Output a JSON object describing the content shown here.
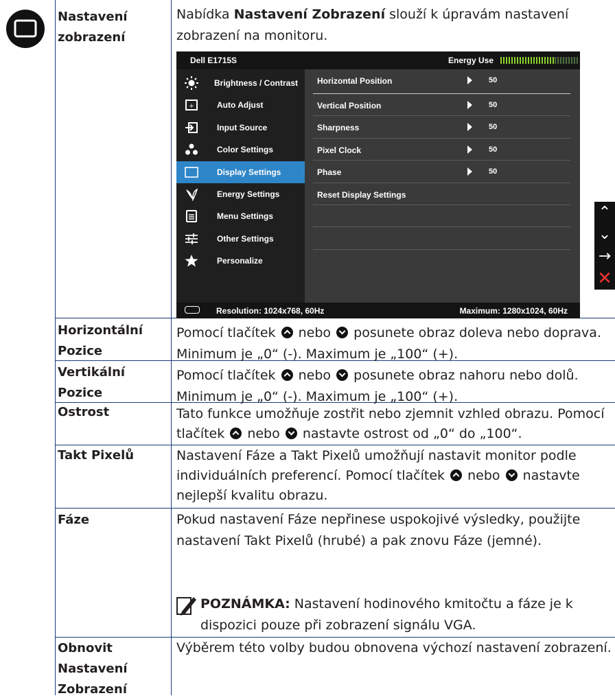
{
  "icon_names": {
    "section": "monitor-circle-icon",
    "note": "pencil-note-icon"
  },
  "colors": {
    "table_border": "#1a3a7a",
    "osd_selected": "#2e86c8",
    "energy_bar": "#8ed12a",
    "exit_key": "#e33333"
  },
  "rows": [
    {
      "label": "Nastavení\nzobrazení",
      "intro_pre": "Nabídka ",
      "intro_bold": "Nastavení Zobrazení",
      "intro_post": " slouží k úpravám nastavení zobrazení na monitoru."
    },
    {
      "label": "Horizontální\nPozice",
      "pre": "Pomocí tlačítek ",
      "mid": " nebo ",
      "post": " posunete obraz doleva nebo doprava. Minimum je „0“ (-). Maximum je „100“ (+)."
    },
    {
      "label": "Vertikální\nPozice",
      "pre": "Pomocí tlačítek ",
      "mid": " nebo ",
      "post": " posunete obraz nahoru nebo dolů. Minimum je „0“ (-). Maximum je „100“ (+)."
    },
    {
      "label": "Ostrost",
      "line1": "Tato funkce umožňuje zostřit nebo zjemnit vzhled obrazu.",
      "pre": "Pomocí tlačítek ",
      "mid": " nebo ",
      "post": " nastavte ostrost od „0“ do „100“."
    },
    {
      "label": "Takt Pixelů",
      "pre": "Nastavení Fáze a Takt Pixelů umožňují nastavit monitor podle individuálních preferencí. Pomocí tlačítek ",
      "mid": " nebo ",
      "post": " nastavte nejlepší kvalitu obrazu."
    },
    {
      "label": "Fáze",
      "text": "Pokud nastavení Fáze nepřinese uspokojivé výsledky, použijte nastavení Takt Pixelů (hrubé) a pak znovu Fáze (jemné).",
      "note_label": "POZNÁMKA:",
      "note_text": " Nastavení hodinového kmitočtu a fáze je k dispozici pouze při zobrazení signálu VGA."
    },
    {
      "label": "Obnovit\nNastavení\nZobrazení",
      "text": "Výběrem této volby budou obnovena výchozí nastavení zobrazení."
    }
  ],
  "osd": {
    "model": "Dell E1715S",
    "energy_label": "Energy Use",
    "menu": [
      {
        "label": "Brightness / Contrast",
        "icon": "sun-icon"
      },
      {
        "label": "Auto Adjust",
        "icon": "auto-adjust-icon"
      },
      {
        "label": "Input Source",
        "icon": "input-source-icon"
      },
      {
        "label": "Color Settings",
        "icon": "color-dots-icon"
      },
      {
        "label": "Display Settings",
        "icon": "display-rect-icon",
        "selected": true
      },
      {
        "label": "Energy Settings",
        "icon": "leaf-icon"
      },
      {
        "label": "Menu Settings",
        "icon": "menu-doc-icon"
      },
      {
        "label": "Other Settings",
        "icon": "sliders-icon"
      },
      {
        "label": "Personalize",
        "icon": "star-icon"
      }
    ],
    "settings": [
      {
        "label": "Horizontal Position",
        "value": "50"
      },
      {
        "label": "Vertical Position",
        "value": "50"
      },
      {
        "label": "Sharpness",
        "value": "50"
      },
      {
        "label": "Pixel Clock",
        "value": "50"
      },
      {
        "label": "Phase",
        "value": "50"
      },
      {
        "label": "Reset Display Settings",
        "value": ""
      }
    ],
    "resolution": "Resolution: 1024x768, 60Hz",
    "maximum": "Maximum: 1280x1024, 60Hz"
  },
  "side_keys": [
    {
      "glyph": "⌃",
      "icon": "chevron-up-icon"
    },
    {
      "glyph": "⌄",
      "icon": "chevron-down-icon"
    },
    {
      "glyph": "→",
      "icon": "arrow-right-icon"
    },
    {
      "glyph": "✕",
      "icon": "close-icon"
    }
  ]
}
